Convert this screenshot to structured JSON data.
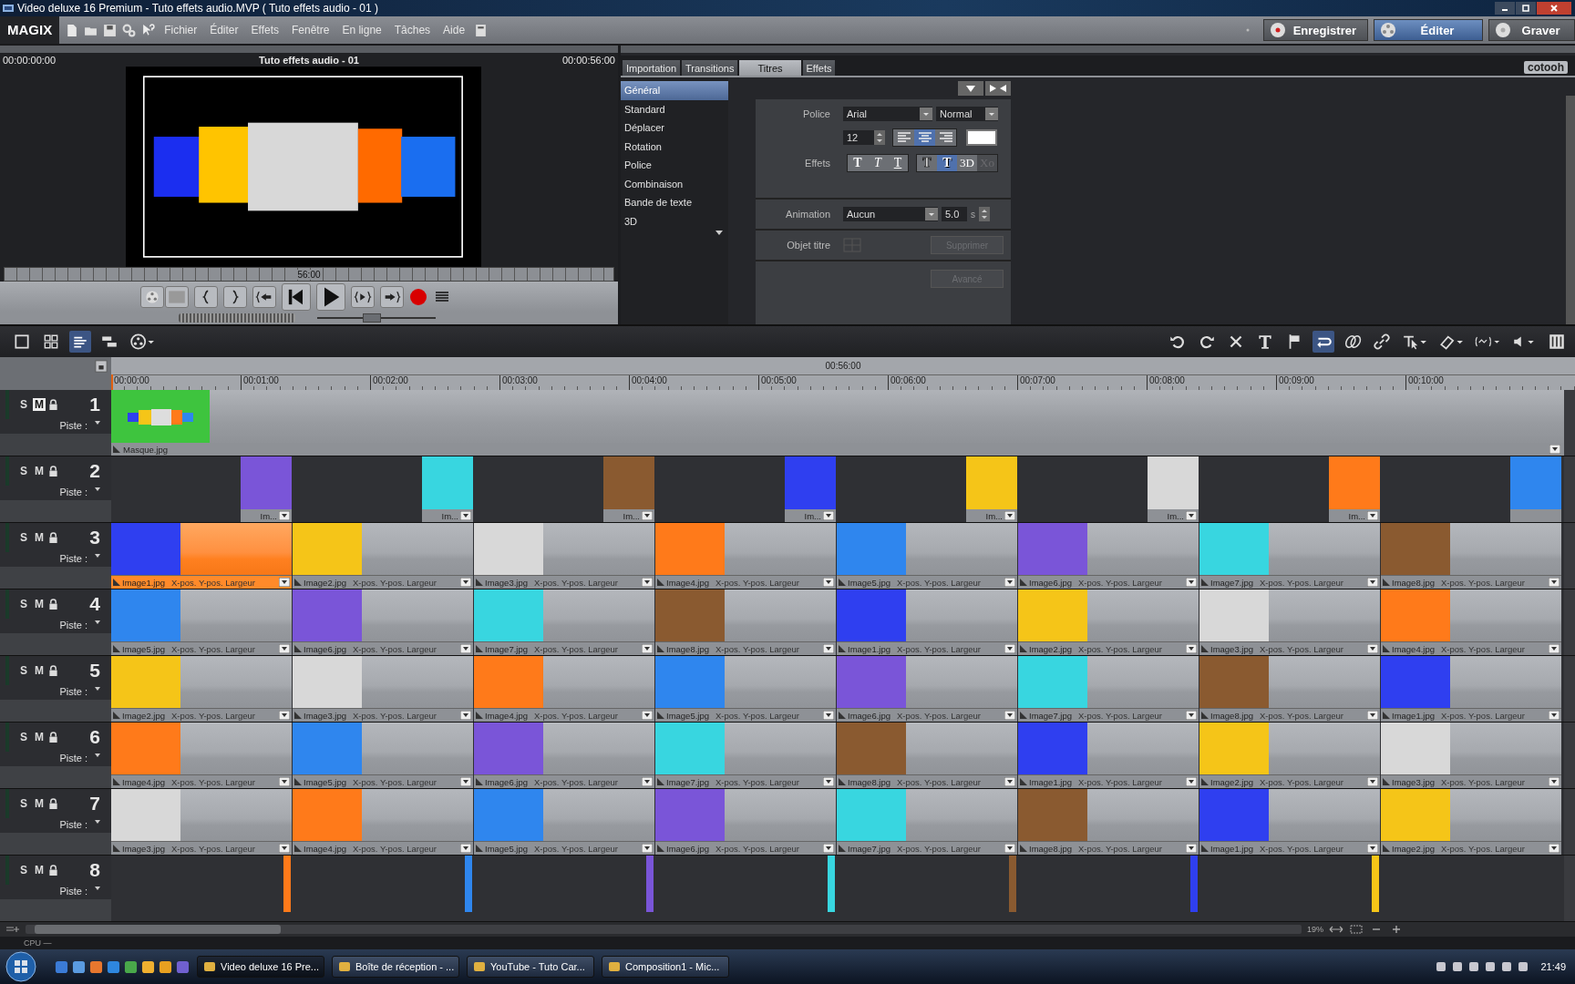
{
  "window": {
    "title": "Video deluxe 16 Premium - Tuto effets audio.MVP ( Tuto effets audio - 01 )"
  },
  "menubar": {
    "logo": "MAGIX",
    "menus": [
      "Fichier",
      "Éditer",
      "Effets",
      "Fenêtre",
      "En ligne",
      "Tâches",
      "Aide"
    ],
    "modes": [
      {
        "label": "Enregistrer",
        "kind": "record",
        "selected": false
      },
      {
        "label": "Éditer",
        "kind": "edit",
        "selected": true
      },
      {
        "label": "Graver",
        "kind": "burn",
        "selected": false
      }
    ]
  },
  "preview": {
    "time_start": "00:00:00:00",
    "title": "Tuto effets audio - 01",
    "time_end": "00:00:56:00",
    "scrub_label": "56:00",
    "zoom_slider": {
      "level": 0.45
    }
  },
  "titles_panel": {
    "logo": "cotooh",
    "tabs": [
      {
        "label": "Importation",
        "selected": false
      },
      {
        "label": "Transitions",
        "selected": false
      },
      {
        "label": "Titres",
        "selected": true
      },
      {
        "label": "Effets",
        "selected": false
      }
    ],
    "categories": [
      {
        "label": "Général",
        "selected": true
      },
      {
        "label": "Standard",
        "selected": false
      },
      {
        "label": "Déplacer",
        "selected": false
      },
      {
        "label": "Rotation",
        "selected": false
      },
      {
        "label": "Police",
        "selected": false
      },
      {
        "label": "Combinaison",
        "selected": false
      },
      {
        "label": "Bande de texte",
        "selected": false
      },
      {
        "label": "3D",
        "selected": false
      }
    ],
    "font_label": "Police",
    "font": "Arial",
    "style": "Normal",
    "size": "12",
    "align": [
      {
        "kind": "left",
        "selected": false
      },
      {
        "kind": "center",
        "selected": true
      },
      {
        "kind": "right",
        "selected": false
      }
    ],
    "effects_label": "Effets",
    "effects": [
      {
        "label": "T",
        "kind": "bold",
        "selected": false,
        "disabled": false
      },
      {
        "label": "T",
        "kind": "italic",
        "selected": false,
        "disabled": false
      },
      {
        "label": "T",
        "kind": "underline",
        "selected": false,
        "disabled": false
      },
      {
        "label": "T",
        "kind": "outline",
        "selected": false,
        "disabled": false
      },
      {
        "label": "T",
        "kind": "shadow",
        "selected": true,
        "disabled": false
      },
      {
        "label": "3D",
        "kind": "plain",
        "selected": false,
        "disabled": false
      },
      {
        "label": "Xo",
        "kind": "plain",
        "selected": false,
        "disabled": true
      }
    ],
    "animation_label": "Animation",
    "animation": "Aucun",
    "duration": "5.0",
    "duration_unit": "s",
    "object_label": "Objet titre",
    "delete_button": {
      "label": "Supprimer",
      "disabled": true
    },
    "advanced_button": {
      "label": "Avancé",
      "disabled": true
    }
  },
  "timeline": {
    "header_time": "00:56:00",
    "ticks": [
      "00:00:00",
      "00:01:00",
      "00:02:00",
      "00:03:00",
      "00:04:00",
      "00:05:00",
      "00:06:00",
      "00:07:00",
      "00:08:00",
      "00:09:00",
      "00:10:00"
    ],
    "tracks": [
      {
        "number": "1",
        "label": "Piste :",
        "solo_label": "S",
        "mute_label": "M",
        "solo": false,
        "mute": true,
        "kind": "mask",
        "clips": [
          {
            "file": "Masque.jpg",
            "color": "#3ec43e",
            "selected": false
          }
        ]
      },
      {
        "number": "2",
        "label": "Piste :",
        "solo_label": "S",
        "mute_label": "M",
        "solo": false,
        "mute": false,
        "kind": "overlay",
        "clips": [
          {
            "file": "Im...",
            "color": "#7a55d8",
            "selected": false
          },
          {
            "file": "Im...",
            "color": "#38d6e0",
            "selected": false
          },
          {
            "file": "Im...",
            "color": "#8a5a30",
            "selected": false
          },
          {
            "file": "Im...",
            "color": "#2f3ff0",
            "selected": false
          },
          {
            "file": "Im...",
            "color": "#f5c518",
            "selected": false
          },
          {
            "file": "Im...",
            "color": "#d8d8d8",
            "selected": false
          },
          {
            "file": "Im...",
            "color": "#ff7a1a",
            "selected": false
          },
          {
            "color": "#2f86ee",
            "selected": false
          }
        ]
      },
      {
        "number": "3",
        "label": "Piste :",
        "solo_label": "S",
        "mute_label": "M",
        "solo": false,
        "mute": false,
        "kind": "sequence",
        "clips": [
          {
            "file": "Image1.jpg",
            "params": "X-pos.  Y-pos.  Largeur",
            "color": "#2f3ff0",
            "selected": true
          },
          {
            "file": "Image2.jpg",
            "params": "X-pos.  Y-pos.  Largeur",
            "color": "#f5c518",
            "selected": false
          },
          {
            "file": "Image3.jpg",
            "params": "X-pos.  Y-pos.  Largeur",
            "color": "#d8d8d8",
            "selected": false
          },
          {
            "file": "Image4.jpg",
            "params": "X-pos.  Y-pos.  Largeur",
            "color": "#ff7a1a",
            "selected": false
          },
          {
            "file": "Image5.jpg",
            "params": "X-pos.  Y-pos.  Largeur",
            "color": "#2f86ee",
            "selected": false
          },
          {
            "file": "Image6.jpg",
            "params": "X-pos.  Y-pos.  Largeur",
            "color": "#7a55d8",
            "selected": false
          },
          {
            "file": "Image7.jpg",
            "params": "X-pos.  Y-pos.  Largeur",
            "color": "#38d6e0",
            "selected": false
          },
          {
            "file": "Image8.jpg",
            "params": "X-pos.  Y-pos.  Largeur",
            "color": "#8a5a30",
            "selected": false
          }
        ]
      },
      {
        "number": "4",
        "label": "Piste :",
        "solo_label": "S",
        "mute_label": "M",
        "solo": false,
        "mute": false,
        "kind": "sequence",
        "clips": [
          {
            "file": "Image5.jpg",
            "params": "X-pos.  Y-pos.  Largeur",
            "color": "#2f86ee",
            "selected": false
          },
          {
            "file": "Image6.jpg",
            "params": "X-pos.  Y-pos.  Largeur",
            "color": "#7a55d8",
            "selected": false
          },
          {
            "file": "Image7.jpg",
            "params": "X-pos.  Y-pos.  Largeur",
            "color": "#38d6e0",
            "selected": false
          },
          {
            "file": "Image8.jpg",
            "params": "X-pos.  Y-pos.  Largeur",
            "color": "#8a5a30",
            "selected": false
          },
          {
            "file": "Image1.jpg",
            "params": "X-pos.  Y-pos.  Largeur",
            "color": "#2f3ff0",
            "selected": false
          },
          {
            "file": "Image2.jpg",
            "params": "X-pos.  Y-pos.  Largeur",
            "color": "#f5c518",
            "selected": false
          },
          {
            "file": "Image3.jpg",
            "params": "X-pos.  Y-pos.  Largeur",
            "color": "#d8d8d8",
            "selected": false
          },
          {
            "file": "Image4.jpg",
            "params": "X-pos.  Y-pos.  Largeur",
            "color": "#ff7a1a",
            "selected": false
          }
        ]
      },
      {
        "number": "5",
        "label": "Piste :",
        "solo_label": "S",
        "mute_label": "M",
        "solo": false,
        "mute": false,
        "kind": "sequence",
        "clips": [
          {
            "file": "Image2.jpg",
            "params": "X-pos.  Y-pos.  Largeur",
            "color": "#f5c518",
            "selected": false
          },
          {
            "file": "Image3.jpg",
            "params": "X-pos.  Y-pos.  Largeur",
            "color": "#d8d8d8",
            "selected": false
          },
          {
            "file": "Image4.jpg",
            "params": "X-pos.  Y-pos.  Largeur",
            "color": "#ff7a1a",
            "selected": false
          },
          {
            "file": "Image5.jpg",
            "params": "X-pos.  Y-pos.  Largeur",
            "color": "#2f86ee",
            "selected": false
          },
          {
            "file": "Image6.jpg",
            "params": "X-pos.  Y-pos.  Largeur",
            "color": "#7a55d8",
            "selected": false
          },
          {
            "file": "Image7.jpg",
            "params": "X-pos.  Y-pos.  Largeur",
            "color": "#38d6e0",
            "selected": false
          },
          {
            "file": "Image8.jpg",
            "params": "X-pos.  Y-pos.  Largeur",
            "color": "#8a5a30",
            "selected": false
          },
          {
            "file": "Image1.jpg",
            "params": "X-pos.  Y-pos.  Largeur",
            "color": "#2f3ff0",
            "selected": false
          }
        ]
      },
      {
        "number": "6",
        "label": "Piste :",
        "solo_label": "S",
        "mute_label": "M",
        "solo": false,
        "mute": false,
        "kind": "sequence",
        "clips": [
          {
            "file": "Image4.jpg",
            "params": "X-pos.  Y-pos.  Largeur",
            "color": "#ff7a1a",
            "selected": false
          },
          {
            "file": "Image5.jpg",
            "params": "X-pos.  Y-pos.  Largeur",
            "color": "#2f86ee",
            "selected": false
          },
          {
            "file": "Image6.jpg",
            "params": "X-pos.  Y-pos.  Largeur",
            "color": "#7a55d8",
            "selected": false
          },
          {
            "file": "Image7.jpg",
            "params": "X-pos.  Y-pos.  Largeur",
            "color": "#38d6e0",
            "selected": false
          },
          {
            "file": "Image8.jpg",
            "params": "X-pos.  Y-pos.  Largeur",
            "color": "#8a5a30",
            "selected": false
          },
          {
            "file": "Image1.jpg",
            "params": "X-pos.  Y-pos.  Largeur",
            "color": "#2f3ff0",
            "selected": false
          },
          {
            "file": "Image2.jpg",
            "params": "X-pos.  Y-pos.  Largeur",
            "color": "#f5c518",
            "selected": false
          },
          {
            "file": "Image3.jpg",
            "params": "X-pos.  Y-pos.  Largeur",
            "color": "#d8d8d8",
            "selected": false
          }
        ]
      },
      {
        "number": "7",
        "label": "Piste :",
        "solo_label": "S",
        "mute_label": "M",
        "solo": false,
        "mute": false,
        "kind": "sequence",
        "clips": [
          {
            "file": "Image3.jpg",
            "params": "X-pos.  Y-pos.  Largeur",
            "color": "#d8d8d8",
            "selected": false
          },
          {
            "file": "Image4.jpg",
            "params": "X-pos.  Y-pos.  Largeur",
            "color": "#ff7a1a",
            "selected": false
          },
          {
            "file": "Image5.jpg",
            "params": "X-pos.  Y-pos.  Largeur",
            "color": "#2f86ee",
            "selected": false
          },
          {
            "file": "Image6.jpg",
            "params": "X-pos.  Y-pos.  Largeur",
            "color": "#7a55d8",
            "selected": false
          },
          {
            "file": "Image7.jpg",
            "params": "X-pos.  Y-pos.  Largeur",
            "color": "#38d6e0",
            "selected": false
          },
          {
            "file": "Image8.jpg",
            "params": "X-pos.  Y-pos.  Largeur",
            "color": "#8a5a30",
            "selected": false
          },
          {
            "file": "Image1.jpg",
            "params": "X-pos.  Y-pos.  Largeur",
            "color": "#2f3ff0",
            "selected": false
          },
          {
            "file": "Image2.jpg",
            "params": "X-pos.  Y-pos.  Largeur",
            "color": "#f5c518",
            "selected": false
          }
        ]
      },
      {
        "number": "8",
        "label": "Piste :",
        "solo_label": "S",
        "mute_label": "M",
        "solo": false,
        "mute": false,
        "kind": "thin",
        "clips": [
          {
            "color": "#ff7a1a",
            "selected": false
          },
          {
            "color": "#2f86ee",
            "selected": false
          },
          {
            "color": "#7a55d8",
            "selected": false
          },
          {
            "color": "#38d6e0",
            "selected": false
          },
          {
            "color": "#8a5a30",
            "selected": false
          },
          {
            "color": "#2f3ff0",
            "selected": false
          },
          {
            "color": "#f5c518",
            "selected": false
          }
        ]
      }
    ]
  },
  "status_bar": {
    "cpu": "CPU —",
    "zoom": "19%"
  },
  "taskbar": {
    "tasks": [
      {
        "label": "Video deluxe 16 Pre...",
        "selected": true
      },
      {
        "label": "Boîte de réception - ...",
        "selected": false
      },
      {
        "label": "YouTube - Tuto Car...",
        "selected": false
      },
      {
        "label": "Composition1 - Mic...",
        "selected": false
      }
    ],
    "clock": "21:49"
  }
}
